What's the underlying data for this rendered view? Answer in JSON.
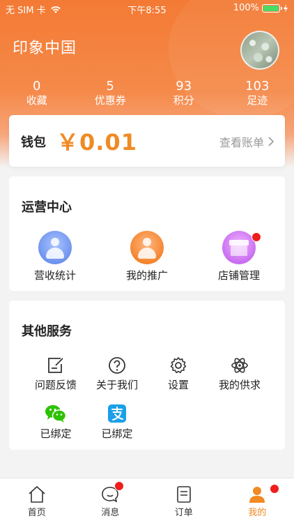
{
  "status_bar": {
    "carrier": "无 SIM 卡",
    "time": "下午8:55",
    "battery": "100%"
  },
  "profile": {
    "shop_name": "印象中国"
  },
  "stats": [
    {
      "value": "0",
      "label": "收藏"
    },
    {
      "value": "5",
      "label": "优惠券"
    },
    {
      "value": "93",
      "label": "积分"
    },
    {
      "value": "103",
      "label": "足迹"
    }
  ],
  "wallet": {
    "label": "钱包",
    "amount": "￥0.01",
    "link": "查看账单"
  },
  "operations": {
    "title": "运营中心",
    "items": [
      {
        "label": "营收统计"
      },
      {
        "label": "我的推广"
      },
      {
        "label": "店铺管理"
      }
    ]
  },
  "services": {
    "title": "其他服务",
    "items": [
      {
        "label": "问题反馈",
        "icon": "feedback-icon"
      },
      {
        "label": "关于我们",
        "icon": "question-icon"
      },
      {
        "label": "设置",
        "icon": "gear-icon"
      },
      {
        "label": "我的供求",
        "icon": "atom-icon"
      },
      {
        "label": "已绑定",
        "icon": "wechat-icon"
      },
      {
        "label": "已绑定",
        "icon": "alipay-icon"
      }
    ]
  },
  "tabbar": [
    {
      "label": "首页",
      "icon": "home-icon"
    },
    {
      "label": "消息",
      "icon": "message-icon"
    },
    {
      "label": "订单",
      "icon": "order-icon"
    },
    {
      "label": "我的",
      "icon": "profile-icon"
    }
  ],
  "colors": {
    "accent": "#f08a24",
    "header": "#f37a34",
    "badge": "#f01d1d"
  }
}
